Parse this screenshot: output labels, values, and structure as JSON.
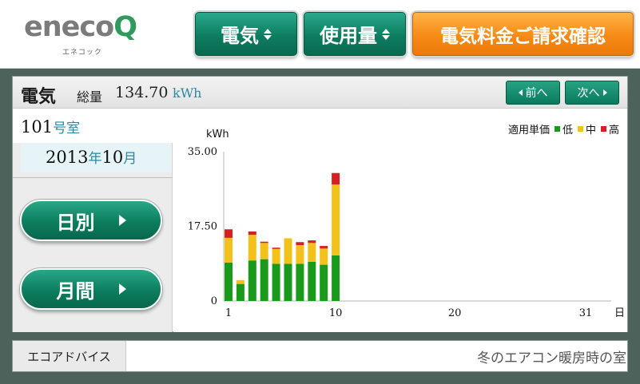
{
  "brand": {
    "logo_text": "eneco",
    "logo_q": "Q",
    "logo_kana": "エネコック"
  },
  "nav": {
    "electricity_label": "電気",
    "usage_label": "使用量",
    "billing_label": "電気料金ご請求確認"
  },
  "panel": {
    "title": "電気",
    "total_label": "総量",
    "total_value": "134.70",
    "total_unit": "kWh",
    "prev_label": "前へ",
    "next_label": "次へ"
  },
  "room": {
    "number": "101",
    "suffix": "号室"
  },
  "period": {
    "year": "2013",
    "year_unit": "年",
    "month": "10",
    "month_unit": "月"
  },
  "view_buttons": {
    "daily": "日別",
    "monthly": "月間"
  },
  "legend": {
    "title": "適用単価",
    "low": "低",
    "mid": "中",
    "high": "高",
    "low_color": "#1a9a1a",
    "mid_color": "#f2c21b",
    "high_color": "#d42020"
  },
  "advice": {
    "label": "エコアドバイス",
    "text": "冬のエアコン暖房時の室"
  },
  "chart_data": {
    "type": "bar",
    "stacked": true,
    "ylabel": "kWh",
    "xlabel": "日",
    "ylim": [
      0,
      35
    ],
    "yticks": [
      "0",
      "17.50",
      "35.00"
    ],
    "xticks": [
      "1",
      "10",
      "20",
      "31"
    ],
    "x_range": [
      1,
      31
    ],
    "categories": [
      1,
      2,
      3,
      4,
      5,
      6,
      7,
      8,
      9,
      10
    ],
    "series": [
      {
        "name": "低",
        "color": "#1a9a1a",
        "values": [
          9.0,
          4.0,
          9.5,
          9.8,
          8.7,
          8.7,
          8.7,
          9.2,
          8.5,
          10.7
        ]
      },
      {
        "name": "中",
        "color": "#f2c21b",
        "values": [
          5.8,
          0.9,
          6.0,
          3.8,
          3.5,
          6.0,
          4.4,
          4.4,
          3.8,
          16.6
        ]
      },
      {
        "name": "高",
        "color": "#d42020",
        "values": [
          2.0,
          0,
          0.8,
          0.3,
          0.3,
          0,
          0.7,
          0.6,
          0.6,
          2.7
        ]
      }
    ]
  }
}
